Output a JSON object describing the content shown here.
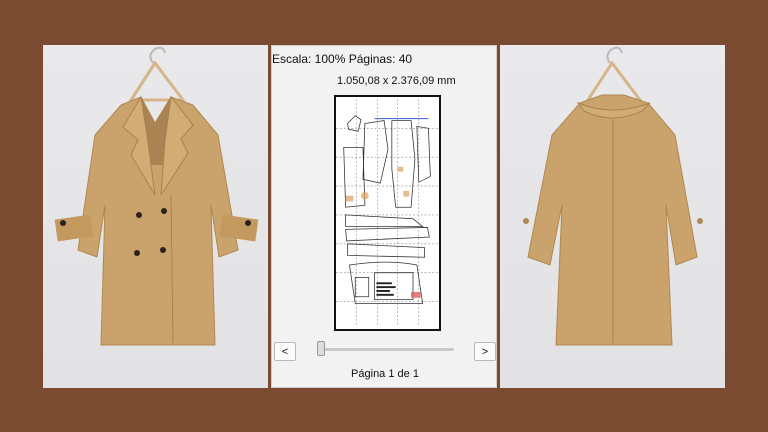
{
  "viewer": {
    "scale_text": "Escala: 100% Páginas: 40",
    "dimensions_text": "1.050,08 x 2.376,09 mm",
    "prev_label": "<",
    "next_label": ">",
    "page_text": "Página 1 de 1",
    "slider_value": 0
  },
  "images": {
    "front": "coat-front-photo",
    "back": "coat-back-photo"
  },
  "colors": {
    "background": "#7a4a31",
    "coat": "#c9a36b",
    "buttons": "#2a211c",
    "panel": "#f2f2f2"
  }
}
